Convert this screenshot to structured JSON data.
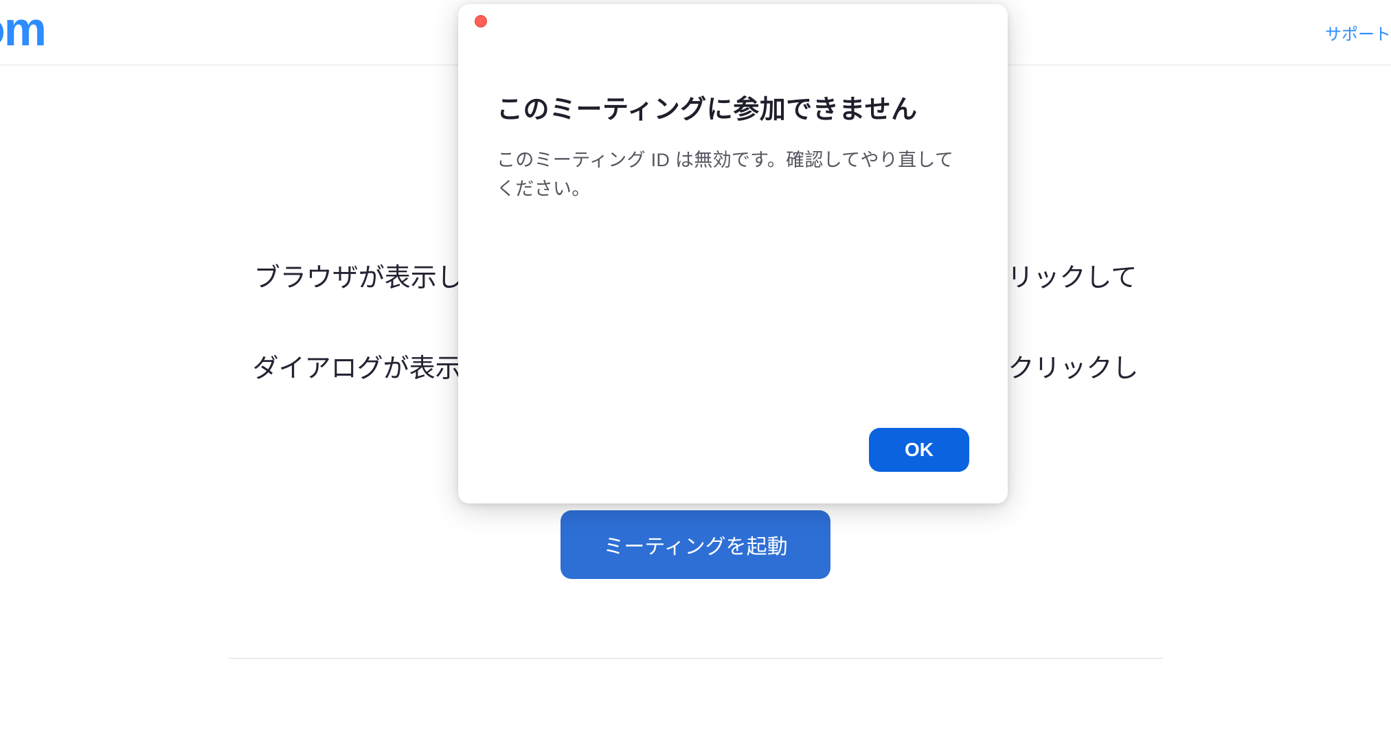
{
  "header": {
    "logo_text": "om",
    "support_label": "サポート"
  },
  "main": {
    "instruction_line1": "ブラウザが表示しているダイアログのZoom Meetingsを開くをクリックしてください",
    "instruction_line2": "ダイアログが表示されない場合は、以下のミーティングを起動をクリックしてく",
    "launch_button_label": "ミーティングを起動"
  },
  "modal": {
    "title": "このミーティングに参加できません",
    "message": "このミーティング ID は無効です。確認してやり直してください。",
    "ok_label": "OK"
  }
}
